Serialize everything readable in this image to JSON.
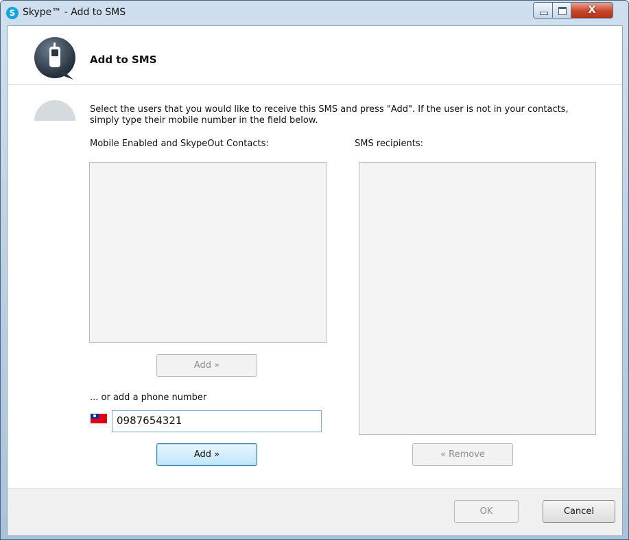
{
  "window": {
    "title": "Skype™ - Add to SMS",
    "app_icon_letter": "S",
    "close_glyph": "X"
  },
  "header": {
    "title": "Add to SMS",
    "icon": "skype-mobile-icon"
  },
  "description": "Select the users that you would like to receive this SMS and press \"Add\". If the user is not in your contacts, simply type their mobile number in the field below.",
  "contacts": {
    "label": "Mobile Enabled and SkypeOut Contacts:",
    "items": [],
    "add_button": "Add »"
  },
  "recipients": {
    "label": "SMS recipients:",
    "items": [],
    "remove_button": "« Remove"
  },
  "phone": {
    "label": "... or add a phone number",
    "value": "0987654321",
    "flag_icon": "taiwan-flag-icon",
    "add_button": "Add »"
  },
  "footer": {
    "ok_button": "OK",
    "cancel_button": "Cancel"
  },
  "colors": {
    "skype_blue": "#15a3e0",
    "close_red": "#c6462a",
    "focus_blue": "#3c7fb1"
  }
}
